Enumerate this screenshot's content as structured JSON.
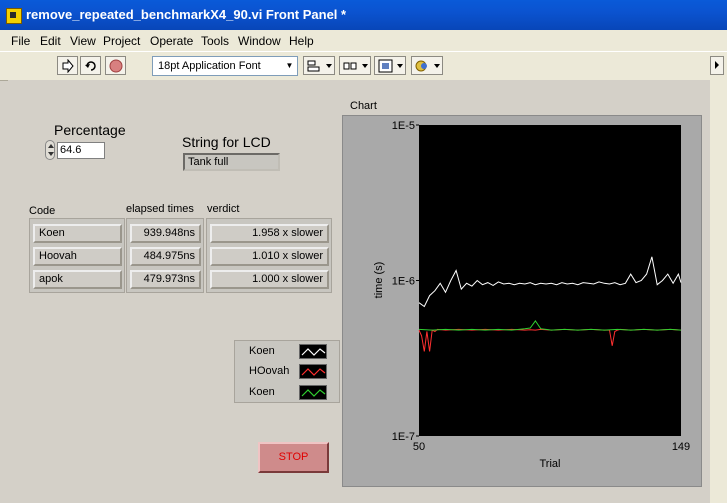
{
  "window": {
    "title": "remove_repeated_benchmarkX4_90.vi Front Panel *"
  },
  "menu": [
    "File",
    "Edit",
    "View",
    "Project",
    "Operate",
    "Tools",
    "Window",
    "Help"
  ],
  "toolbar": {
    "font": "18pt Application Font"
  },
  "percentage": {
    "label": "Percentage",
    "value": "64.6"
  },
  "lcd": {
    "label": "String for LCD",
    "value": "Tank full"
  },
  "table": {
    "headers": [
      "Code",
      "elapsed times",
      "verdict"
    ],
    "rows": [
      {
        "code": "Koen",
        "time": "939.948ns",
        "verdict": "1.958 x slower"
      },
      {
        "code": "Hoovah",
        "time": "484.975ns",
        "verdict": "1.010 x slower"
      },
      {
        "code": "apok",
        "time": "479.973ns",
        "verdict": "1.000 x slower"
      }
    ]
  },
  "legend": [
    {
      "name": "Koen",
      "color": "#ffffff"
    },
    {
      "name": "HOovah",
      "color": "#ff3030"
    },
    {
      "name": "Koen",
      "color": "#30d030"
    }
  ],
  "stop_label": "STOP",
  "chart_data": {
    "type": "line",
    "title": "Chart",
    "xlabel": "Trial",
    "ylabel": "time (s)",
    "xlim": [
      50,
      149
    ],
    "ylim": [
      1e-07,
      1e-05
    ],
    "yscale": "log",
    "x_ticks": [
      "50",
      "149"
    ],
    "y_ticks": [
      "1E-5",
      "1E-6",
      "1E-7"
    ],
    "background": "#000000",
    "series": [
      {
        "name": "Koen",
        "color": "#ffffff",
        "x": [
          50,
          52,
          54,
          56,
          58,
          60,
          62,
          64,
          66,
          68,
          70,
          72,
          74,
          76,
          78,
          80,
          82,
          84,
          86,
          88,
          90,
          92,
          94,
          96,
          98,
          100,
          102,
          104,
          106,
          108,
          110,
          112,
          114,
          116,
          118,
          120,
          122,
          124,
          126,
          128,
          130,
          132,
          134,
          136,
          138,
          140,
          142,
          144,
          146,
          148,
          149
        ],
        "values": [
          7.2e-07,
          6.8e-07,
          8e-07,
          8.6e-07,
          9.6e-07,
          8.4e-07,
          1e-06,
          1.16e-06,
          8.8e-07,
          9.6e-07,
          9.2e-07,
          1e-06,
          9.4e-07,
          9.7e-07,
          9.3e-07,
          9.8e-07,
          9.5e-07,
          9.6e-07,
          9.4e-07,
          9.6e-07,
          9.5e-07,
          9.7e-07,
          9.4e-07,
          9.6e-07,
          9.5e-07,
          9.6e-07,
          9.4e-07,
          9.7e-07,
          9.5e-07,
          9.6e-07,
          9.4e-07,
          9.7e-07,
          9.6e-07,
          9.5e-07,
          9.8e-07,
          9.6e-07,
          9.5e-07,
          9.7e-07,
          9.4e-07,
          9.6e-07,
          1.1e-06,
          9.7e-07,
          1e-06,
          1.1e-06,
          1.42e-06,
          9.4e-07,
          1e-06,
          1.1e-06,
          9.6e-07,
          1.1e-06,
          9.7e-07
        ]
      },
      {
        "name": "HOovah",
        "color": "#ff3030",
        "x": [
          50,
          51,
          52,
          53,
          54,
          55,
          56,
          57,
          60,
          65,
          70,
          75,
          80,
          85,
          90,
          92,
          94,
          96,
          100,
          105,
          110,
          115,
          120,
          122,
          123,
          124,
          125,
          126,
          130,
          135,
          140,
          145,
          149
        ],
        "values": [
          4.8e-07,
          4.4e-07,
          3.5e-07,
          4.7e-07,
          3.5e-07,
          4.8e-07,
          4.7e-07,
          4.85e-07,
          4.8e-07,
          4.85e-07,
          4.8e-07,
          4.85e-07,
          4.8e-07,
          4.85e-07,
          4.8e-07,
          4.82e-07,
          4.8e-07,
          4.85e-07,
          4.8e-07,
          4.85e-07,
          4.8e-07,
          4.85e-07,
          4.8e-07,
          4.8e-07,
          3.8e-07,
          4.7e-07,
          4.8e-07,
          4.85e-07,
          4.8e-07,
          4.85e-07,
          4.8e-07,
          4.85e-07,
          4.8e-07
        ]
      },
      {
        "name": "Koen",
        "color": "#30d030",
        "x": [
          50,
          55,
          60,
          65,
          70,
          75,
          80,
          85,
          90,
          92,
          94,
          96,
          98,
          100,
          105,
          110,
          115,
          120,
          125,
          130,
          135,
          140,
          145,
          149
        ],
        "values": [
          4.85e-07,
          4.8e-07,
          4.85e-07,
          4.8e-07,
          4.85e-07,
          4.8e-07,
          4.85e-07,
          4.8e-07,
          4.9e-07,
          4.95e-07,
          5.5e-07,
          4.9e-07,
          4.85e-07,
          4.8e-07,
          4.85e-07,
          4.8e-07,
          4.85e-07,
          4.8e-07,
          4.85e-07,
          4.8e-07,
          4.85e-07,
          4.8e-07,
          4.85e-07,
          4.8e-07
        ]
      }
    ]
  }
}
